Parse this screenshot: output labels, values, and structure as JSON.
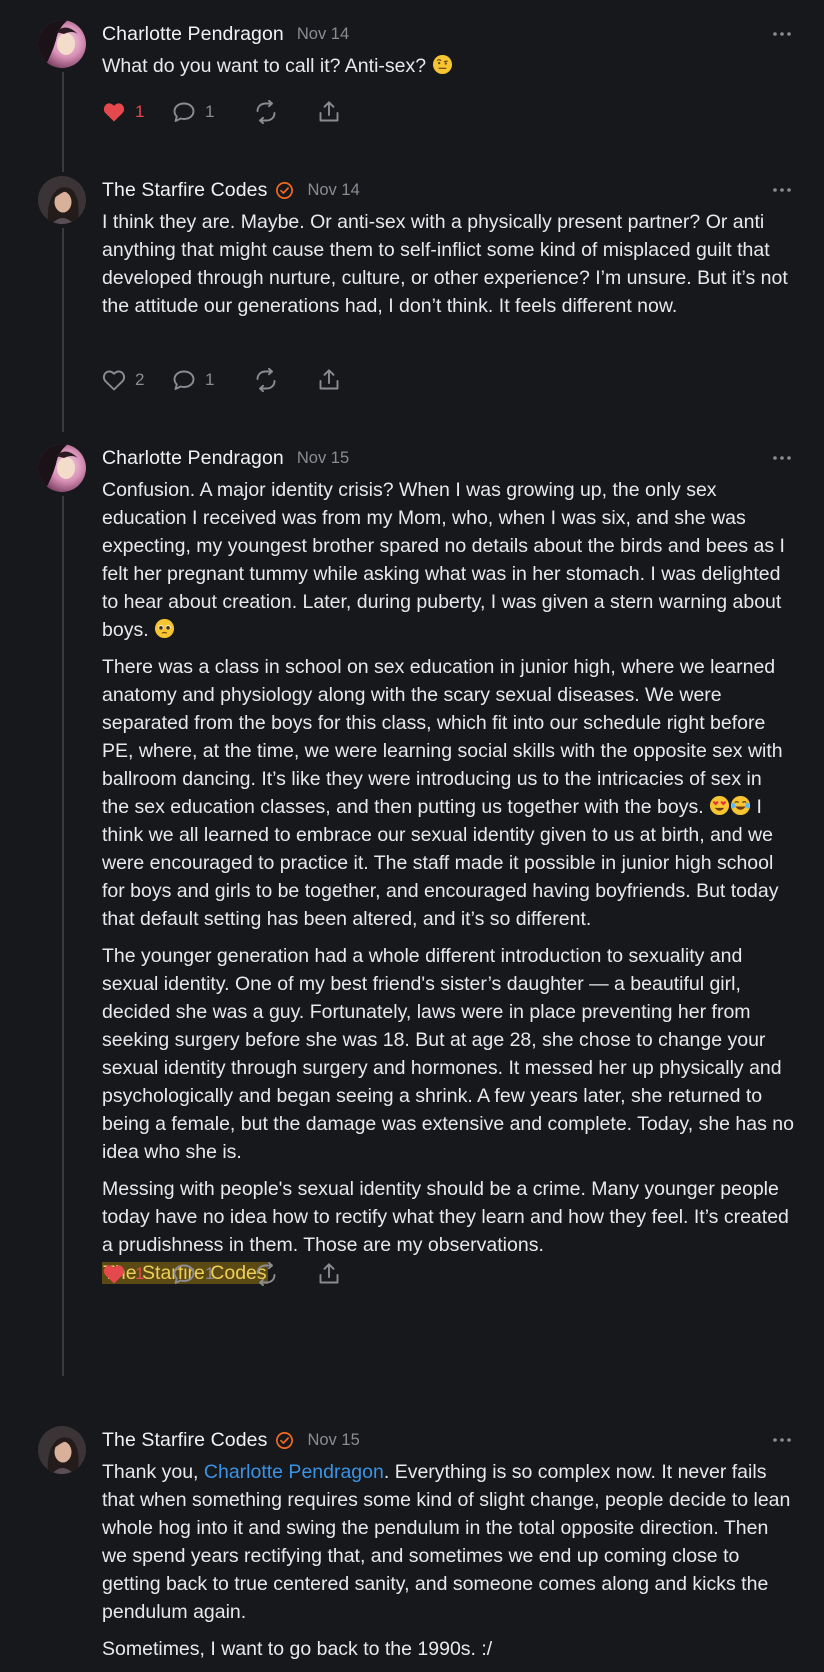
{
  "comments": [
    {
      "author": "Charlotte Pendragon",
      "date": "Nov 14",
      "verified": false,
      "avatar": "charlotte-avatar",
      "paragraphs": [
        {
          "text": "What do you want to call it? Anti-sex?",
          "trailing_emoji": "face-with-raised-eyebrow"
        }
      ],
      "likes": "1",
      "liked": true,
      "replies": "1"
    },
    {
      "author": "The Starfire Codes",
      "date": "Nov 14",
      "verified": true,
      "avatar": "starfire-avatar",
      "paragraphs": [
        {
          "text": "I think they are. Maybe. Or anti-sex with a physically present partner? Or anti anything that might cause them to self-inflict some kind of misplaced guilt that developed through nurture, culture, or other experience? I’m unsure. But it’s not the attitude our generations had, I don’t think. It feels different now."
        }
      ],
      "likes": "2",
      "liked": false,
      "replies": "1"
    },
    {
      "author": "Charlotte Pendragon",
      "date": "Nov 15",
      "verified": false,
      "avatar": "charlotte-avatar",
      "paragraphs": [
        {
          "text": "Confusion. A major identity crisis? When I was growing up, the only sex education I received was from my Mom, who, when I was six, and she was expecting, my youngest brother spared no details about the birds and bees as I felt her pregnant tummy while asking what was in her stomach. I was delighted to hear about creation. Later, during puberty, I was given a stern warning about boys.",
          "trailing_emoji": "pleading-face"
        },
        {
          "text_before": "There was a class in school on sex education in junior high, where we learned anatomy and physiology along with the scary sexual diseases. We were separated from the boys for this class, which fit into our schedule right before PE, where, at the time, we were learning social skills with the opposite sex with ballroom dancing. It’s like they were introducing us to the intricacies of sex in the sex education classes, and then putting us together with the boys.",
          "inline_emojis": [
            "heart-eyes-face",
            "tears-of-joy-face"
          ],
          "text_after": "I think we all learned to embrace our sexual identity given to us at birth, and we were encouraged to practice it. The staff made it possible in junior high school for boys and girls to be together, and encouraged having boyfriends. But today that default setting has been altered, and it’s so different."
        },
        {
          "text": "The younger generation had a whole different introduction to sexuality and sexual identity. One of my best friend's sister’s daughter — a beautiful girl, decided she was a guy. Fortunately, laws were in place preventing her from seeking surgery before she was 18. But at age 28, she chose to change your sexual identity through surgery and hormones. It messed her up physically and psychologically and began seeing a shrink. A few years later, she returned to being a female, but the damage was extensive and complete. Today, she has no idea who she is."
        },
        {
          "text": "Messing with people's sexual identity should be a crime. Many younger people today have no idea how to rectify what they learn and how they feel. It’s created a prudishness in them. Those are my observations.",
          "highlight": "The Starfire Codes"
        }
      ],
      "likes": "1",
      "liked": true,
      "replies": "1"
    },
    {
      "author": "The Starfire Codes",
      "date": "Nov 15",
      "verified": true,
      "avatar": "starfire-avatar",
      "paragraphs": [
        {
          "text_before": "Thank you, ",
          "mention": "Charlotte Pendragon",
          "text_after": ". Everything is so complex now. It never fails that when something requires some kind of slight change, people decide to lean whole hog into it and swing the pendulum in the total opposite direction. Then we spend years rectifying that, and sometimes we end up coming close to getting back to true centered sanity, and someone comes along and kicks the pendulum again."
        },
        {
          "text": "Sometimes, I want to go back to the 1990s. :/"
        }
      ]
    }
  ],
  "icons": {
    "like": "heart-icon",
    "reply": "comment-icon",
    "restack": "restack-icon",
    "share": "share-icon",
    "more": "more-options-icon",
    "verified": "verified-badge-icon"
  },
  "colors": {
    "background": "#17181b",
    "text": "#e9e9eb",
    "muted": "#8b8c92",
    "liked": "#e5484d",
    "verified": "#f26a21",
    "mention": "#3b93e6",
    "highlight_bg": "#5b4a14",
    "highlight_text": "#f0cf59"
  }
}
